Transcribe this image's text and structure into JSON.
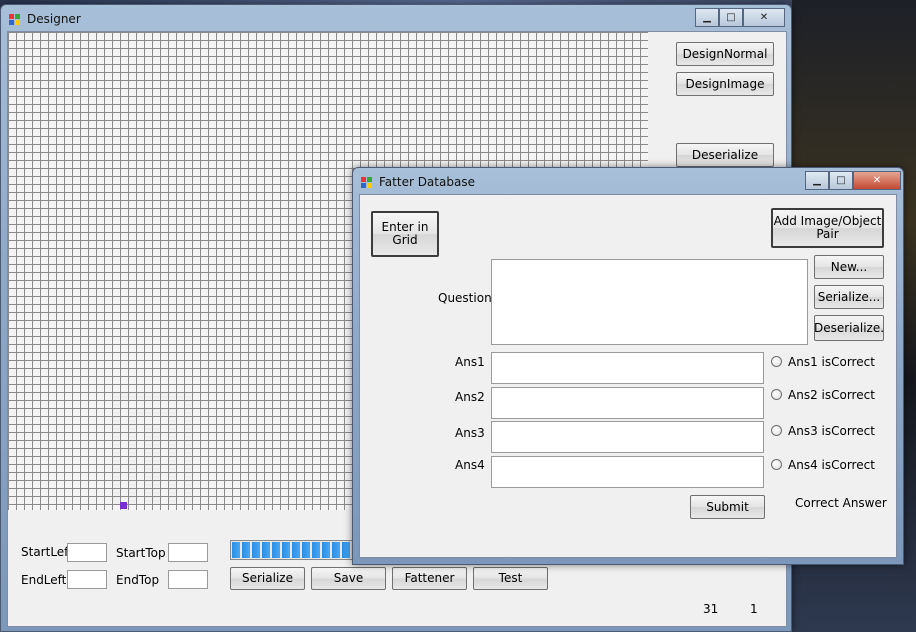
{
  "designer": {
    "title": "Designer",
    "buttons": {
      "design_normal": "DesignNormal",
      "design_image": "DesignImage",
      "deserialize": "Deserialize",
      "serialize": "Serialize",
      "save": "Save",
      "fattener": "Fattener",
      "test": "Test"
    },
    "labels": {
      "start_left": "StartLeft",
      "start_top": "StartTop",
      "end_left": "EndLeft",
      "end_top": "EndTop"
    },
    "inputs": {
      "start_left": "",
      "start_top": "",
      "end_left": "",
      "end_top": ""
    },
    "progress_fraction": 1.0,
    "status": {
      "count_a": "31",
      "count_b": "1"
    },
    "highlight_color": "#7a2fd0"
  },
  "fatter": {
    "title": "Fatter Database",
    "buttons": {
      "enter_in_grid": "Enter in Grid",
      "add_pair": "Add Image/Object Pair",
      "new": "New...",
      "serialize": "Serialize...",
      "deserialize": "Deserialize.",
      "submit": "Submit"
    },
    "labels": {
      "question": "Question",
      "ans1": "Ans1",
      "ans2": "Ans2",
      "ans3": "Ans3",
      "ans4": "Ans4",
      "correct_answer": "Correct Answer"
    },
    "radios": [
      "Ans1 isCorrect",
      "Ans2 isCorrect",
      "Ans3 isCorrect",
      "Ans4 isCorrect"
    ],
    "question_value": "",
    "answers": [
      "",
      "",
      "",
      ""
    ]
  }
}
